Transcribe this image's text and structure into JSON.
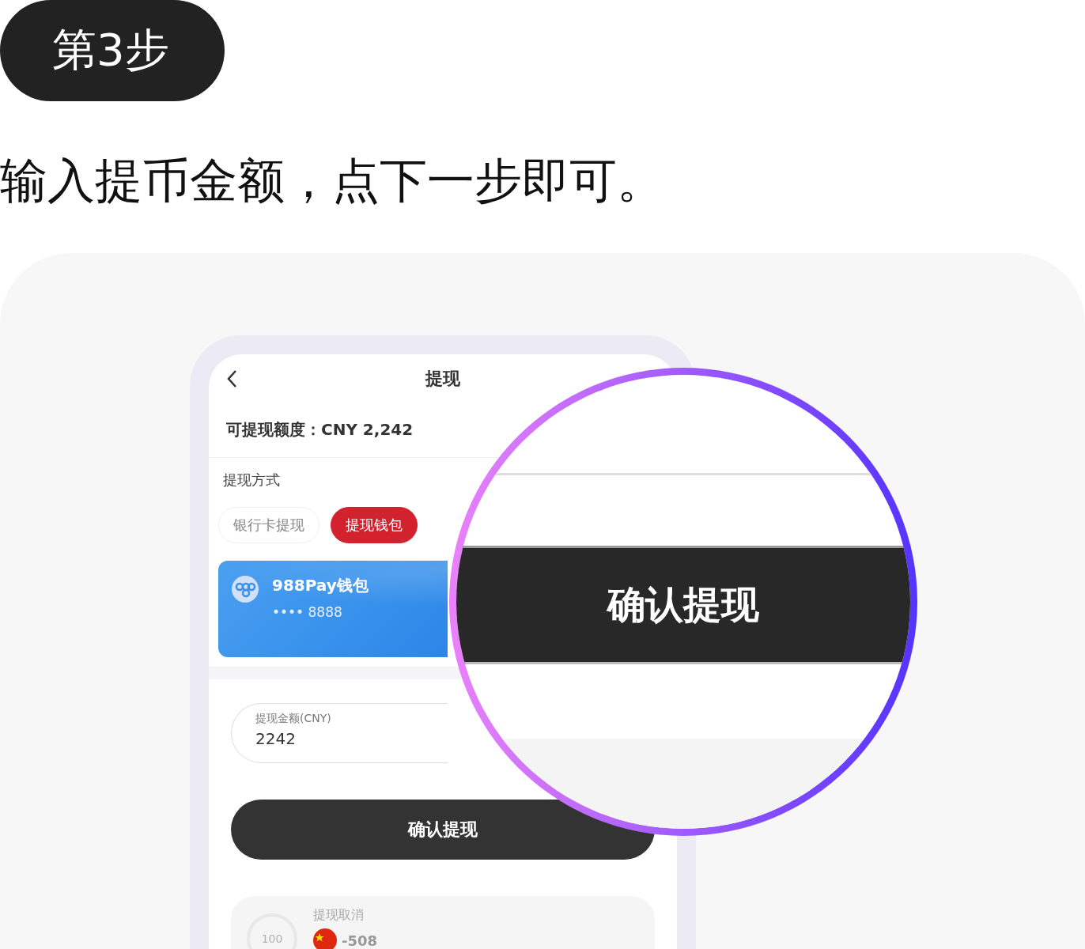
{
  "step_badge": "第3步",
  "instruction": "输入提币金额，点下一步即可。",
  "phone": {
    "title": "提现",
    "balance": "可提现额度：CNY 2,242",
    "method_label": "提现方式",
    "methods": [
      {
        "label": "银行卡提现",
        "selected": false
      },
      {
        "label": "提现钱包",
        "selected": true
      }
    ],
    "wallet_card": {
      "name": "988Pay钱包",
      "number": "•••• 8888"
    },
    "amount_field": {
      "label": "提现金额(CNY)",
      "value": "2242"
    },
    "confirm_button": "确认提现",
    "record": {
      "badge": "100",
      "title": "提现取消",
      "amount": "-508"
    }
  },
  "magnifier": {
    "button": "确认提现"
  }
}
